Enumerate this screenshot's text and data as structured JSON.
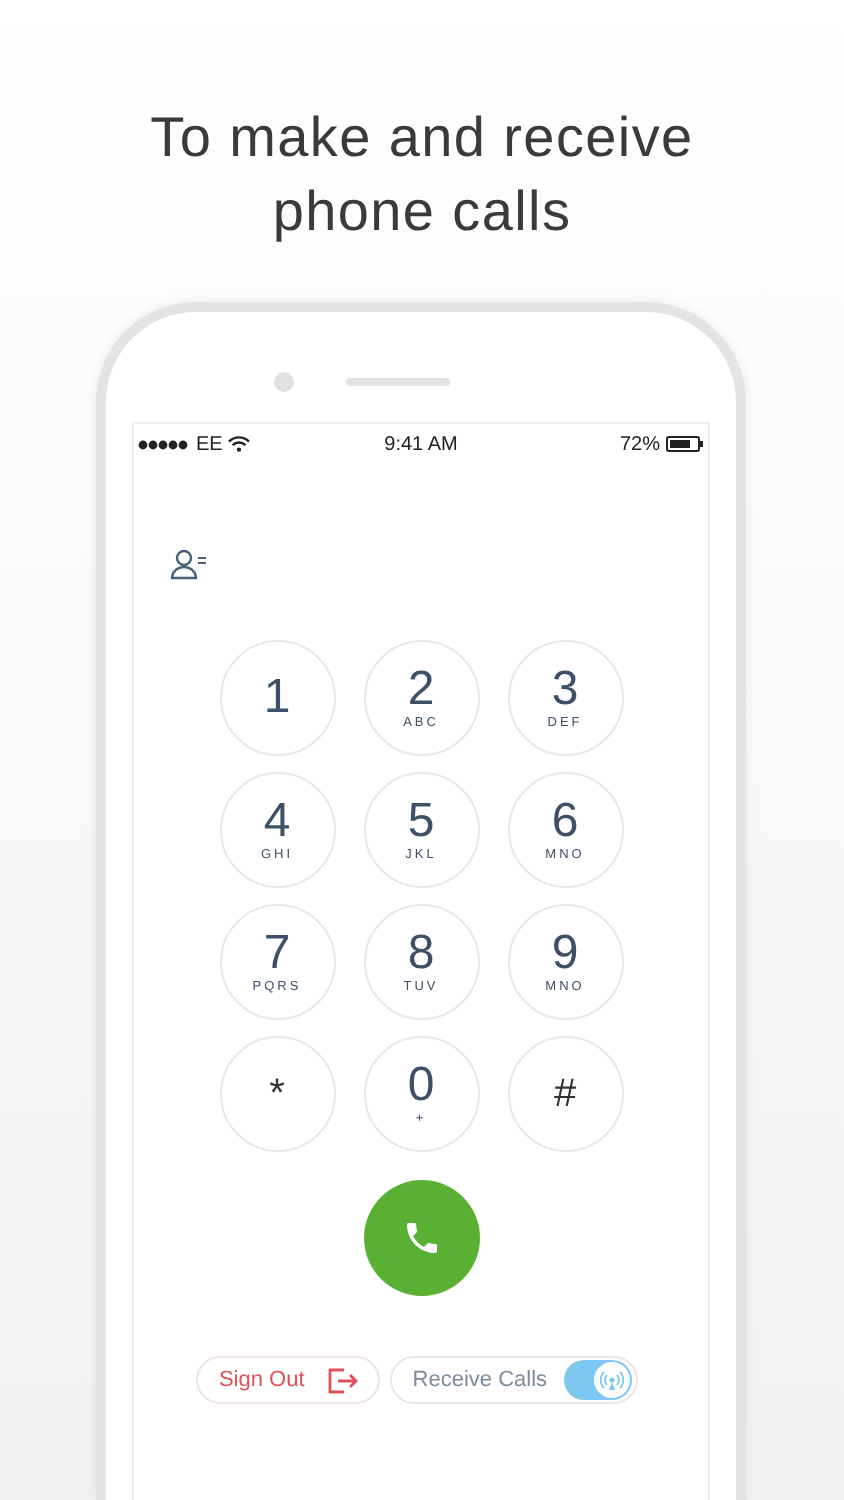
{
  "headline": "To make and receive phone calls",
  "status_bar": {
    "carrier": "EE",
    "time": "9:41 AM",
    "battery": "72%"
  },
  "keypad": [
    {
      "digit": "1"
    },
    {
      "digit": "2",
      "letters": "ABC"
    },
    {
      "digit": "3",
      "letters": "DEF"
    },
    {
      "digit": "4",
      "letters": "GHI"
    },
    {
      "digit": "5",
      "letters": "JKL"
    },
    {
      "digit": "6",
      "letters": "MNO"
    },
    {
      "digit": "7",
      "letters": "PQRS"
    },
    {
      "digit": "8",
      "letters": "TUV"
    },
    {
      "digit": "9",
      "letters": "MNO"
    },
    {
      "digit": "*",
      "kind": "symbol"
    },
    {
      "digit": "0",
      "letters": "+"
    },
    {
      "digit": "#",
      "kind": "symbol"
    }
  ],
  "sign_out": {
    "label": "Sign Out"
  },
  "receive_calls": {
    "label": "Receive Calls",
    "on": true
  }
}
